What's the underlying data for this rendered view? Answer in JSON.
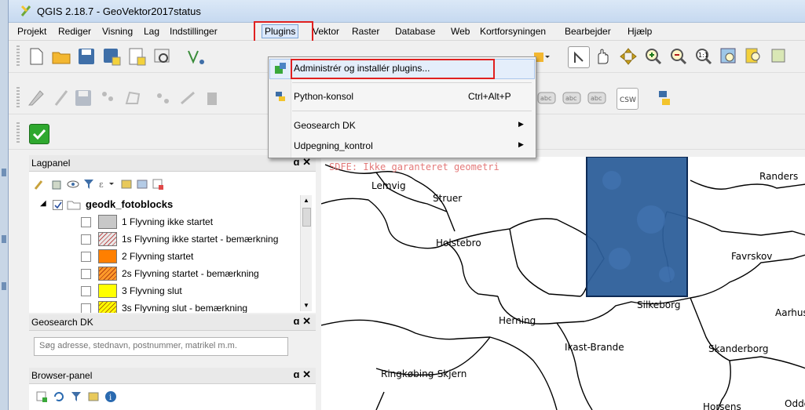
{
  "window": {
    "title": "QGIS 2.18.7 - GeoVektor2017status"
  },
  "menubar": {
    "items": [
      "Projekt",
      "Rediger",
      "Visning",
      "Lag",
      "Indstillinger",
      "Plugins",
      "Vektor",
      "Raster",
      "Database",
      "Web",
      "Kortforsyningen",
      "Bearbejder",
      "Hjælp"
    ]
  },
  "plugins_menu": {
    "items": [
      {
        "label": "Administrér og installér plugins...",
        "shortcut": ""
      },
      {
        "label": "Python-konsol",
        "shortcut": "Ctrl+Alt+P"
      },
      {
        "label": "Geosearch DK",
        "shortcut": ""
      },
      {
        "label": "Udpegning_kontrol",
        "shortcut": ""
      }
    ]
  },
  "panels": {
    "layers": {
      "title": "Lagpanel",
      "group": "geodk_fotoblocks",
      "items": [
        {
          "label": "1 Flyvning ikke startet",
          "color": "#c8c8c8",
          "hatched": false
        },
        {
          "label": "1s Flyvning ikke startet - bemærkning",
          "color": "#d8d8d8",
          "hatched": true
        },
        {
          "label": "2 Flyvning startet",
          "color": "#ff7f00",
          "hatched": false
        },
        {
          "label": "2s  Flyvning startet - bemærkning",
          "color": "#ff9a2a",
          "hatched": true
        },
        {
          "label": "3 Flyvning slut",
          "color": "#ffff00",
          "hatched": false
        },
        {
          "label": "3s Flyvning slut - bemærkning",
          "color": "#ffff00",
          "hatched": true
        }
      ]
    },
    "geosearch": {
      "title": "Geosearch DK",
      "placeholder": "Søg adresse, stednavn, postnummer, matrikel m.m."
    },
    "browser": {
      "title": "Browser-panel"
    }
  },
  "map": {
    "watermark": "SDFE: Ikke garanteret geometri",
    "labels": [
      "Lemvig",
      "Struer",
      "Holstebro",
      "Randers",
      "Favrskov",
      "Silkeborg",
      "Aarhus",
      "Herning",
      "Ikast-Brande",
      "Skanderborg",
      "Ringkøbing-Skjern",
      "Horsens",
      "Odde"
    ]
  },
  "colors": {
    "highlight": "#e02020",
    "menu_active": "#dbe8fb",
    "raster": "#2d5f9a"
  },
  "icons": [
    "new-project-icon",
    "open-project-icon",
    "save-icon",
    "save-as-icon",
    "pan-icon",
    "zoom-in-icon",
    "zoom-out-icon",
    "python-icon",
    "csw-icon",
    "check-icon"
  ]
}
